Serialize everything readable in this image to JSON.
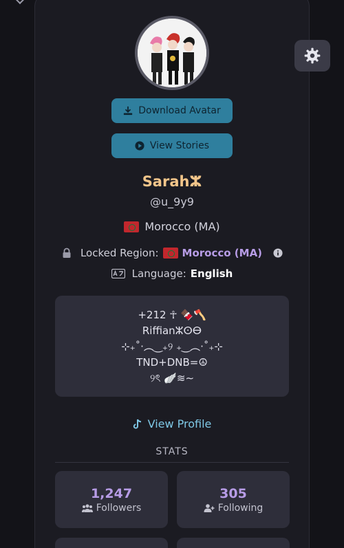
{
  "profile": {
    "display_name": "Sarahⵣ",
    "username": "@u_9y9",
    "country": "Morocco (MA)"
  },
  "actions": {
    "download_avatar": "Download Avatar",
    "view_stories": "View Stories",
    "view_profile": "View Profile"
  },
  "region": {
    "label": "Locked Region:",
    "value": "Morocco (MA)"
  },
  "language": {
    "label": "Language:",
    "value": "English"
  },
  "bio": {
    "lines": [
      "+212 ☥ 🍫🪓",
      "Riffianⵣⵙⴱ",
      "⊹₊˚‧︵‿₊୨ ₊‿︵‧˚₊⊹",
      "TND+DNB=☮",
      "୨ৎ 🪽≋∼"
    ]
  },
  "stats": {
    "title": "STATS",
    "followers_value": "1,247",
    "followers_label": "Followers",
    "following_value": "305",
    "following_label": "Following"
  },
  "colors": {
    "accent_button": "#2f7f9e",
    "name": "#f2c58a",
    "highlight": "#b79ce6",
    "link": "#7fc8e6"
  },
  "icons": {
    "settings": "gear-icon",
    "download": "download-icon",
    "stories": "play-circle-icon",
    "lock": "lock-icon",
    "info": "info-icon",
    "language": "translate-icon",
    "tiktok": "tiktok-icon",
    "followers": "users-icon",
    "following": "user-plus-icon"
  }
}
